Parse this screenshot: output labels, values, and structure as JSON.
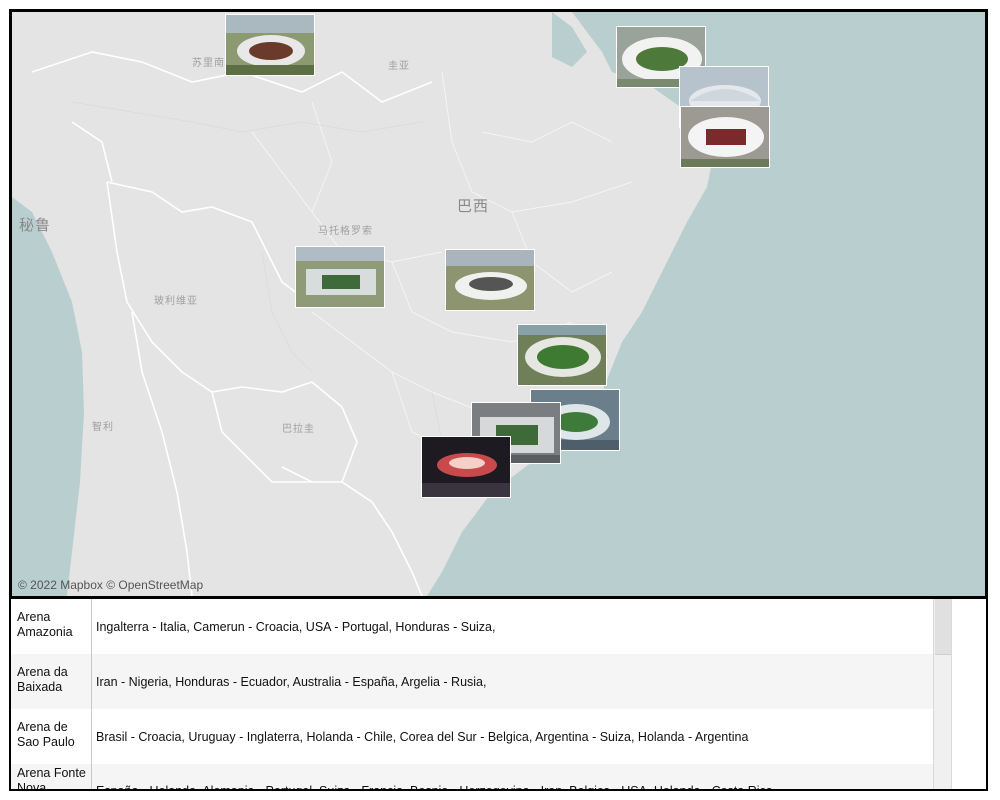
{
  "map": {
    "attribution": "© 2022 Mapbox © OpenStreetMap",
    "labels": {
      "suriname": "苏里南",
      "guyana_fr": "圭亚",
      "peru": "秘鲁",
      "brazil": "巴西",
      "mato_grosso": "马托格罗索",
      "bolivia": "玻利维亚",
      "paraguay": "巴拉圭",
      "chile": "智利"
    },
    "colors": {
      "ocean": "#b9cfcf",
      "land": "#e4e4e4",
      "border": "#ffffff"
    },
    "stadium_markers": [
      {
        "name": "stadium-marker-manaus",
        "color": "#6b7a4e"
      },
      {
        "name": "stadium-marker-fortaleza",
        "color": "#8a8f8c"
      },
      {
        "name": "stadium-marker-natal",
        "color": "#9aa6b0"
      },
      {
        "name": "stadium-marker-recife",
        "color": "#7d6f6a"
      },
      {
        "name": "stadium-marker-cuiaba",
        "color": "#7c8a6a"
      },
      {
        "name": "stadium-marker-brasilia",
        "color": "#8c8f72"
      },
      {
        "name": "stadium-marker-belo-horizonte",
        "color": "#6f7e5a"
      },
      {
        "name": "stadium-marker-rio",
        "color": "#5d6f80"
      },
      {
        "name": "stadium-marker-sao-paulo",
        "color": "#787878"
      },
      {
        "name": "stadium-marker-curitiba",
        "color": "#3a2a2e"
      }
    ]
  },
  "table": {
    "rows": [
      {
        "stadium": "Arena Amazonia",
        "matches": "Ingalterra - Italia,   Camerun - Croacia,   USA - Portugal,   Honduras - Suiza,"
      },
      {
        "stadium": "Arena da Baixada",
        "matches": "Iran - Nigeria, Honduras - Ecuador,   Australia - España,   Argelia - Rusia,"
      },
      {
        "stadium": "Arena de Sao Paulo",
        "matches": "Brasil - Croacia,  Uruguay - Inglaterra,   Holanda - Chile,   Corea del Sur - Belgica,   Argentina - Suiza,   Holanda - Argentina"
      },
      {
        "stadium": "Arena Fonte Nova",
        "matches": "España - Holanda,  Alemania - Portugal,  Suiza - Francia,  Bosnia - Herzegovina - Iran,  Belgica - USA,  Holanda - Costa Rica"
      }
    ]
  }
}
